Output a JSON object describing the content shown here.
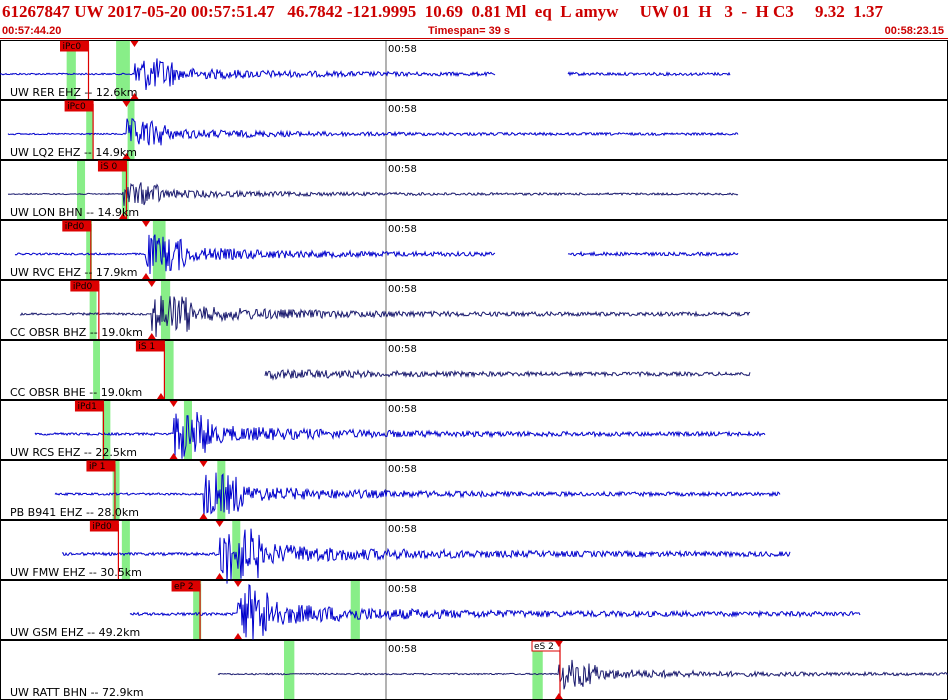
{
  "header": {
    "title": "61267847 UW 2017-05-20 00:57:51.47   46.7842 -121.9995  10.69  0.81 Ml  eq  L amyw     UW 01  H   3  -  H C3     9.32  1.37",
    "start_time": "00:57:44.20",
    "timespan": "Timespan=  39 s",
    "end_time": "00:58:23.15"
  },
  "colors": {
    "header_text": "#cc0000",
    "trace_primary": "#0000cc",
    "trace_dark": "#1a1a6e",
    "pick_tag": "#dd0000",
    "pick_tag_light": "#ff8888",
    "window_highlight": "#88ee88",
    "border": "#000000"
  },
  "panels": [
    {
      "label": "UW RER EHZ -- 12.6km",
      "minute": "00:58",
      "pick": "iPc0",
      "seg_ranges": [
        [
          0,
          495
        ],
        [
          568,
          730
        ]
      ],
      "amp": 7,
      "color": "primary",
      "pick_time": 27.0,
      "event_time": 31.0,
      "green_windows": [
        [
          25.1,
          25.9
        ],
        [
          29.4,
          30.6
        ]
      ]
    },
    {
      "label": "UW LQ2 EHZ -- 14.9km",
      "minute": "00:58",
      "pick": "iPc0",
      "seg_ranges": [
        [
          8,
          738
        ]
      ],
      "amp": 6,
      "color": "primary",
      "pick_time": 27.4,
      "event_time": 30.3,
      "green_windows": [
        [
          26.8,
          27.4
        ],
        [
          30.4,
          31.0
        ]
      ]
    },
    {
      "label": "UW LON BHN -- 14.9km",
      "minute": "00:58",
      "pick": "iS 0",
      "seg_ranges": [
        [
          8,
          738
        ]
      ],
      "amp": 5,
      "color": "dark",
      "pick_time": 30.3,
      "event_time": 30.0,
      "green_windows": [
        [
          26.0,
          26.7
        ],
        [
          29.9,
          30.5
        ]
      ]
    },
    {
      "label": "UW RVC EHZ -- 17.9km",
      "minute": "00:58",
      "pick": "iPd0",
      "seg_ranges": [
        [
          15,
          495
        ],
        [
          568,
          738
        ]
      ],
      "amp": 8,
      "color": "primary",
      "pick_time": 27.2,
      "event_time": 32.0,
      "green_windows": [
        [
          26.8,
          27.3
        ],
        [
          32.6,
          33.7
        ]
      ]
    },
    {
      "label": "CC OBSR BHZ -- 19.0km",
      "minute": "00:58",
      "pick": "iPd0",
      "seg_ranges": [
        [
          20,
          750
        ]
      ],
      "amp": 9,
      "color": "dark",
      "pick_time": 27.9,
      "event_time": 32.5,
      "green_windows": [
        [
          27.1,
          27.7
        ],
        [
          33.3,
          34.1
        ]
      ]
    },
    {
      "label": "CC OBSR BHE -- 19.0km",
      "minute": "00:58",
      "pick": "iS 1",
      "seg_ranges": [
        [
          265,
          750
        ]
      ],
      "amp": 9,
      "color": "dark",
      "pick_time": 33.6,
      "event_time": 33.3,
      "green_windows": [
        [
          27.4,
          28.0
        ],
        [
          33.6,
          34.4
        ]
      ]
    },
    {
      "label": "UW RCS EHZ -- 22.5km",
      "minute": "00:58",
      "pick": "iPd1",
      "seg_ranges": [
        [
          35,
          765
        ]
      ],
      "amp": 10,
      "color": "primary",
      "pick_time": 28.3,
      "event_time": 34.4,
      "green_windows": [
        [
          28.2,
          28.9
        ],
        [
          35.3,
          36.0
        ]
      ]
    },
    {
      "label": "PB B941 EHZ -- 28.0km",
      "minute": "00:58",
      "pick": "iP 1",
      "seg_ranges": [
        [
          55,
          780
        ]
      ],
      "amp": 9,
      "color": "primary",
      "pick_time": 29.3,
      "event_time": 37.0,
      "green_windows": [
        [
          29.1,
          29.7
        ],
        [
          38.2,
          38.9
        ]
      ]
    },
    {
      "label": "UW FMW EHZ -- 30.5km",
      "minute": "00:58",
      "pick": "iPd0",
      "seg_ranges": [
        [
          62,
          790
        ]
      ],
      "amp": 12,
      "color": "primary",
      "pick_time": 29.6,
      "event_time": 38.4,
      "green_windows": [
        [
          29.9,
          30.6
        ],
        [
          39.5,
          40.2
        ]
      ]
    },
    {
      "label": "UW GSM EHZ -- 49.2km",
      "minute": "00:58",
      "pick": "eP 2",
      "seg_ranges": [
        [
          130,
          860
        ]
      ],
      "amp": 12,
      "color": "primary",
      "pick_time": 36.7,
      "event_time": 40.0,
      "green_windows": [
        [
          36.1,
          36.8
        ],
        [
          49.8,
          50.6
        ]
      ]
    },
    {
      "label": "UW RATT BHN -- 72.9km",
      "minute": "00:58",
      "pick": "eS 2",
      "seg_ranges": [
        [
          218,
          948
        ]
      ],
      "amp": 6,
      "color": "dark",
      "pick_time": 68.0,
      "event_time": 67.9,
      "green_windows": [
        [
          44.0,
          44.9
        ],
        [
          65.6,
          66.5
        ]
      ]
    }
  ]
}
